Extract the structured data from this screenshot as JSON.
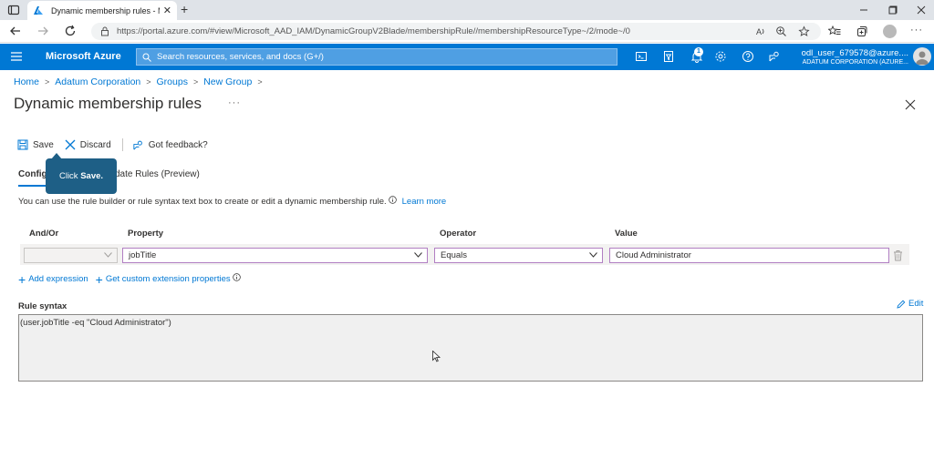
{
  "browser": {
    "tab_title": "Dynamic membership rules - Mi",
    "url": "https://portal.azure.com/#view/Microsoft_AAD_IAM/DynamicGroupV2Blade/membershipRule//membershipResourceType~/2/mode~/0",
    "icons": [
      "window-icon",
      "azure-favicon",
      "close-icon",
      "new-tab-icon",
      "minimize-icon",
      "maximize-icon",
      "close-window-icon",
      "back-icon",
      "forward-icon",
      "refresh-icon",
      "lock-icon",
      "read-aloud-icon",
      "zoom-icon",
      "favorite-icon",
      "favorites-icon",
      "collections-icon",
      "profile-icon",
      "more-icon"
    ]
  },
  "azure_header": {
    "brand": "Microsoft Azure",
    "search_placeholder": "Search resources, services, and docs (G+/)",
    "notification_count": "1",
    "username": "odl_user_679578@azure....",
    "org": "ADATUM CORPORATION (AZURE..."
  },
  "breadcrumb": [
    "Home",
    "Adatum Corporation",
    "Groups",
    "New Group"
  ],
  "page": {
    "title": "Dynamic membership rules",
    "more": "···"
  },
  "commands": {
    "save": "Save",
    "discard": "Discard",
    "feedback": "Got feedback?"
  },
  "tabs": {
    "configure": "Config",
    "validate": "date Rules (Preview)"
  },
  "callout": {
    "prefix": "Click ",
    "bold": "Save."
  },
  "info": {
    "text": "You can use the rule builder or rule syntax text box to create or edit a dynamic membership rule.",
    "learn_more": "Learn more"
  },
  "grid": {
    "headers": {
      "andor": "And/Or",
      "property": "Property",
      "operator": "Operator",
      "value": "Value"
    },
    "row": {
      "andor": "",
      "property": "jobTitle",
      "operator": "Equals",
      "value": "Cloud Administrator"
    }
  },
  "links": {
    "add_expression": "Add expression",
    "custom_ext": "Get custom extension properties"
  },
  "rule_syntax": {
    "label": "Rule syntax",
    "edit": "Edit",
    "text": "(user.jobTitle -eq \"Cloud Administrator\")"
  },
  "colors": {
    "azure_blue": "#0078d4",
    "callout_bg": "#1e5f86",
    "focus_border": "#b17fc3"
  }
}
